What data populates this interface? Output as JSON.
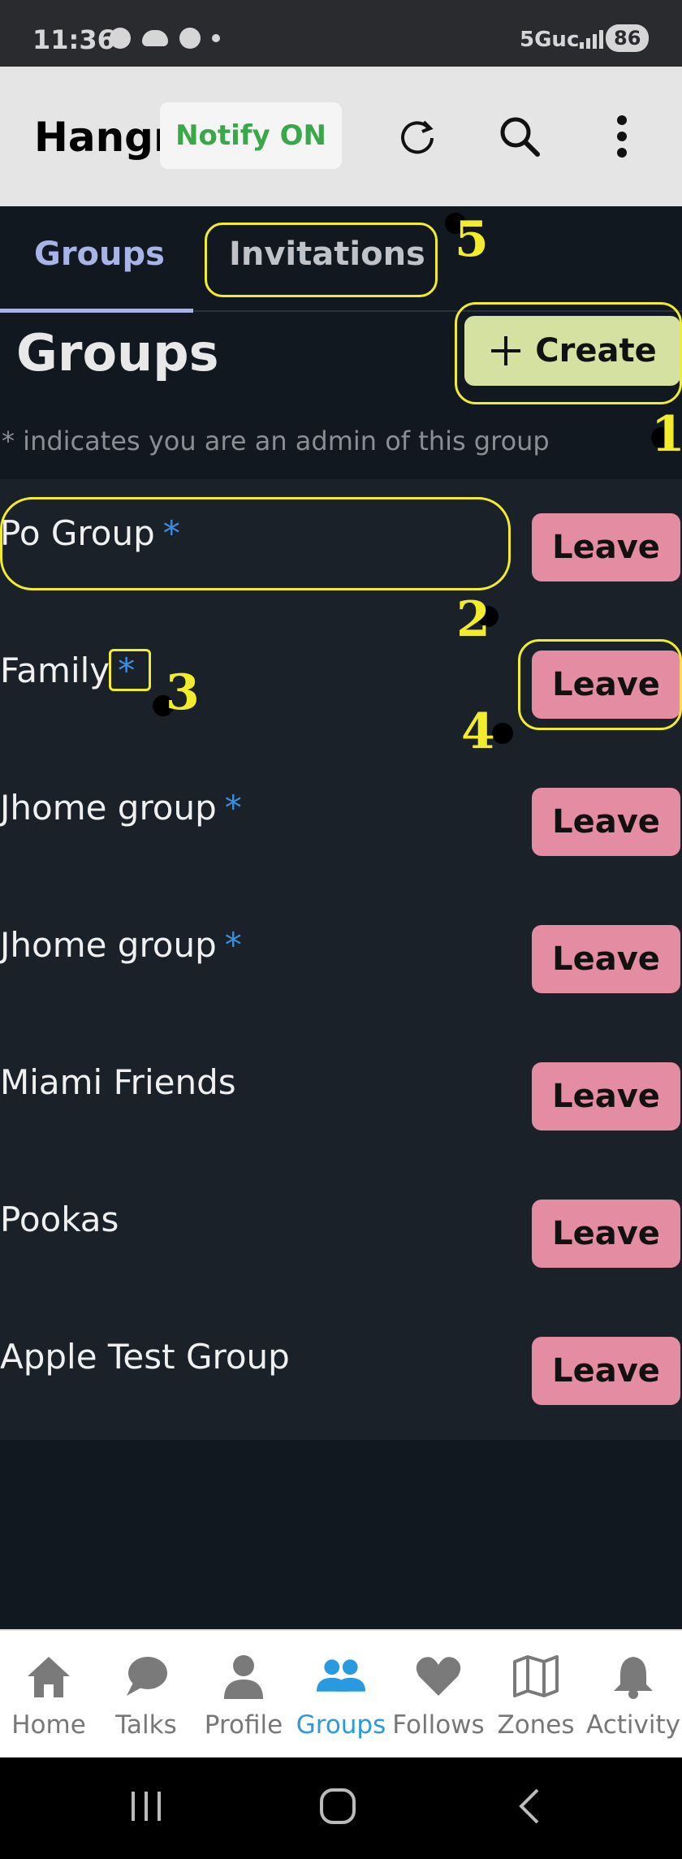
{
  "status_bar": {
    "time": "11:36",
    "network": "5Guc",
    "battery": "86"
  },
  "app_bar": {
    "title": "Hangn",
    "notify_label": "Notify ON"
  },
  "tabs": [
    {
      "label": "Groups",
      "active": true
    },
    {
      "label": "Invitations",
      "active": false
    }
  ],
  "section": {
    "title": "Groups",
    "create_label": "Create",
    "hint": "* indicates you are an admin of this group"
  },
  "groups": [
    {
      "name": "Po Group",
      "admin_marker": "*",
      "leave_label": "Leave"
    },
    {
      "name": "Family",
      "admin_marker": "*",
      "leave_label": "Leave"
    },
    {
      "name": "Jhome group",
      "admin_marker": "*",
      "leave_label": "Leave"
    },
    {
      "name": "Jhome group",
      "admin_marker": "*",
      "leave_label": "Leave"
    },
    {
      "name": "Miami Friends",
      "admin_marker": "",
      "leave_label": "Leave"
    },
    {
      "name": "Pookas",
      "admin_marker": "",
      "leave_label": "Leave"
    },
    {
      "name": "Apple Test Group",
      "admin_marker": "",
      "leave_label": "Leave"
    }
  ],
  "annotations": [
    "1",
    "2",
    "3",
    "4",
    "5"
  ],
  "bottom_nav": [
    {
      "label": "Home",
      "icon": "home-icon"
    },
    {
      "label": "Talks",
      "icon": "chat-icon"
    },
    {
      "label": "Profile",
      "icon": "person-icon"
    },
    {
      "label": "Groups",
      "icon": "groups-icon",
      "active": true
    },
    {
      "label": "Follows",
      "icon": "heart-icon"
    },
    {
      "label": "Zones",
      "icon": "map-icon"
    },
    {
      "label": "Activity",
      "icon": "bell-icon"
    }
  ],
  "colors": {
    "accent": "#a8b4e8",
    "create": "#d5e1a0",
    "leave": "#e48ca2",
    "admin_star": "#3b8fe0",
    "active_nav": "#2a9ae0",
    "annotation": "#f2ec2c"
  }
}
